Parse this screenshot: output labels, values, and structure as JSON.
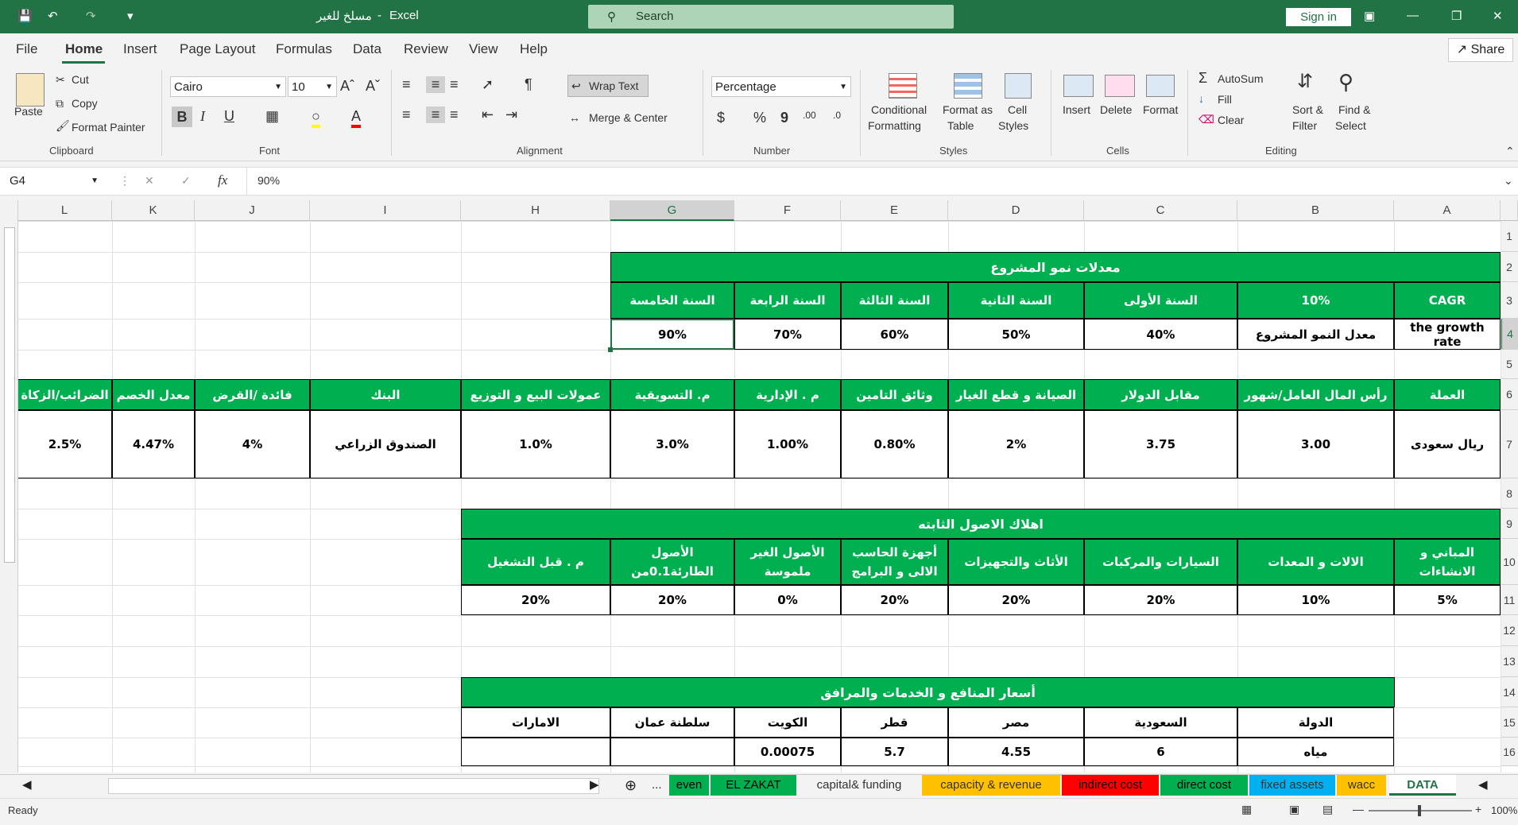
{
  "window": {
    "file_title": "مسلخ للغير",
    "app_name": "Excel",
    "separator": "-"
  },
  "search": {
    "label": "Search"
  },
  "account": {
    "sign_in": "Sign in"
  },
  "menu": {
    "items": [
      "File",
      "Home",
      "Insert",
      "Page Layout",
      "Formulas",
      "Data",
      "Review",
      "View",
      "Help"
    ],
    "share": "Share"
  },
  "ribbon": {
    "clipboard": {
      "paste": "Paste",
      "cut": "Cut",
      "copy": "Copy",
      "format_painter": "Format Painter",
      "group": "Clipboard"
    },
    "font": {
      "name": "Cairo",
      "size": "10",
      "bold": "B",
      "italic": "I",
      "underline": "U",
      "group": "Font"
    },
    "alignment": {
      "wrap_text": "Wrap Text",
      "merge_center": "Merge & Center",
      "group": "Alignment"
    },
    "number": {
      "format": "Percentage",
      "currency": "$",
      "percent": "%",
      "comma": "9",
      "group": "Number"
    },
    "styles": {
      "conditional": "Conditional",
      "formatting": "Formatting",
      "format_as": "Format as",
      "table": "Table",
      "cell": "Cell",
      "styles_label": "Styles",
      "group": "Styles"
    },
    "cells": {
      "insert": "Insert",
      "delete": "Delete",
      "format": "Format",
      "group": "Cells"
    },
    "editing": {
      "autosum": "AutoSum",
      "fill": "Fill",
      "clear": "Clear",
      "sort": "Sort &",
      "filter": "Filter",
      "find": "Find &",
      "select": "Select",
      "group": "Editing"
    }
  },
  "formula_bar": {
    "name_box": "G4",
    "fx": "fx",
    "value": "90%"
  },
  "columns": [
    "L",
    "K",
    "J",
    "I",
    "H",
    "G",
    "F",
    "E",
    "D",
    "C",
    "B",
    "A"
  ],
  "rows": [
    "1",
    "2",
    "3",
    "4",
    "5",
    "6",
    "7",
    "8",
    "9",
    "10",
    "11",
    "12",
    "13",
    "14",
    "15",
    "16"
  ],
  "sheet": {
    "growth_title": "معدلات نمو المشروع",
    "cagr": "CAGR",
    "cagr_value": "10%",
    "years": [
      "السنة الأولى",
      "السنة الثانية",
      "السنة الثالثة",
      "السنة الرابعة",
      "السنة الخامسة"
    ],
    "growth_rate_en": "the growth rate",
    "growth_rate_ar": "معدل النمو المشروع",
    "growth_values": [
      "40%",
      "50%",
      "60%",
      "70%",
      "90%"
    ],
    "params_headers": [
      "العملة",
      "رأس المال العامل/شهور",
      "مقابل الدولار",
      "الصيانة و قطع الغيار",
      "وثائق التامين",
      "م . الإدارية",
      "م. التسويقية",
      "عمولات البيع و التوزيع",
      "البنك",
      "فائدة /القرض",
      "معدل الخصم",
      "الضرائب/الزكاة"
    ],
    "params_values": [
      "ريال سعودى",
      "3.00",
      "3.75",
      "2%",
      "0.80%",
      "1.00%",
      "3.0%",
      "1.0%",
      "الصندوق الزراعي",
      "4%",
      "4.47%",
      "2.5%"
    ],
    "dep_title": "اهلاك الاصول الثابته",
    "dep_headers": [
      "المباني و الانشاءات",
      "الالات و المعدات",
      "السيارات والمركبات",
      "الأثاث والتجهيزات",
      "أجهزة الحاسب الالى و البرامج",
      "الأصول الغير ملموسة",
      "الأصول الطارئة0.1من",
      "م . قبل التشغيل"
    ],
    "dep_values": [
      "5%",
      "10%",
      "20%",
      "20%",
      "20%",
      "0%",
      "20%",
      "20%"
    ],
    "util_title": "أسعار المنافع و الخدمات والمرافق",
    "util_headers": [
      "الدولة",
      "السعودية",
      "مصر",
      "قطر",
      "الكويت",
      "سلطنة عمان",
      "الامارات"
    ],
    "util_row_label": "مياه",
    "util_values": [
      "6",
      "4.55",
      "5.7",
      "0.00075",
      "",
      ""
    ]
  },
  "sheet_tabs": {
    "ellipsis": "...",
    "items": [
      {
        "label": "even",
        "color": "#00b050"
      },
      {
        "label": "EL ZAKAT",
        "color": "#00b050"
      },
      {
        "label": "capital& funding",
        "color": "#f3f3f3"
      },
      {
        "label": "capacity & revenue",
        "color": "#ffc000"
      },
      {
        "label": "indirect cost",
        "color": "#ff0000"
      },
      {
        "label": "direct cost",
        "color": "#00b050"
      },
      {
        "label": "fixed assets",
        "color": "#00b0f0"
      },
      {
        "label": "wacc",
        "color": "#ffc000"
      },
      {
        "label": "DATA",
        "color": "#ffffff"
      }
    ]
  },
  "status": {
    "ready": "Ready",
    "zoom": "100%"
  }
}
